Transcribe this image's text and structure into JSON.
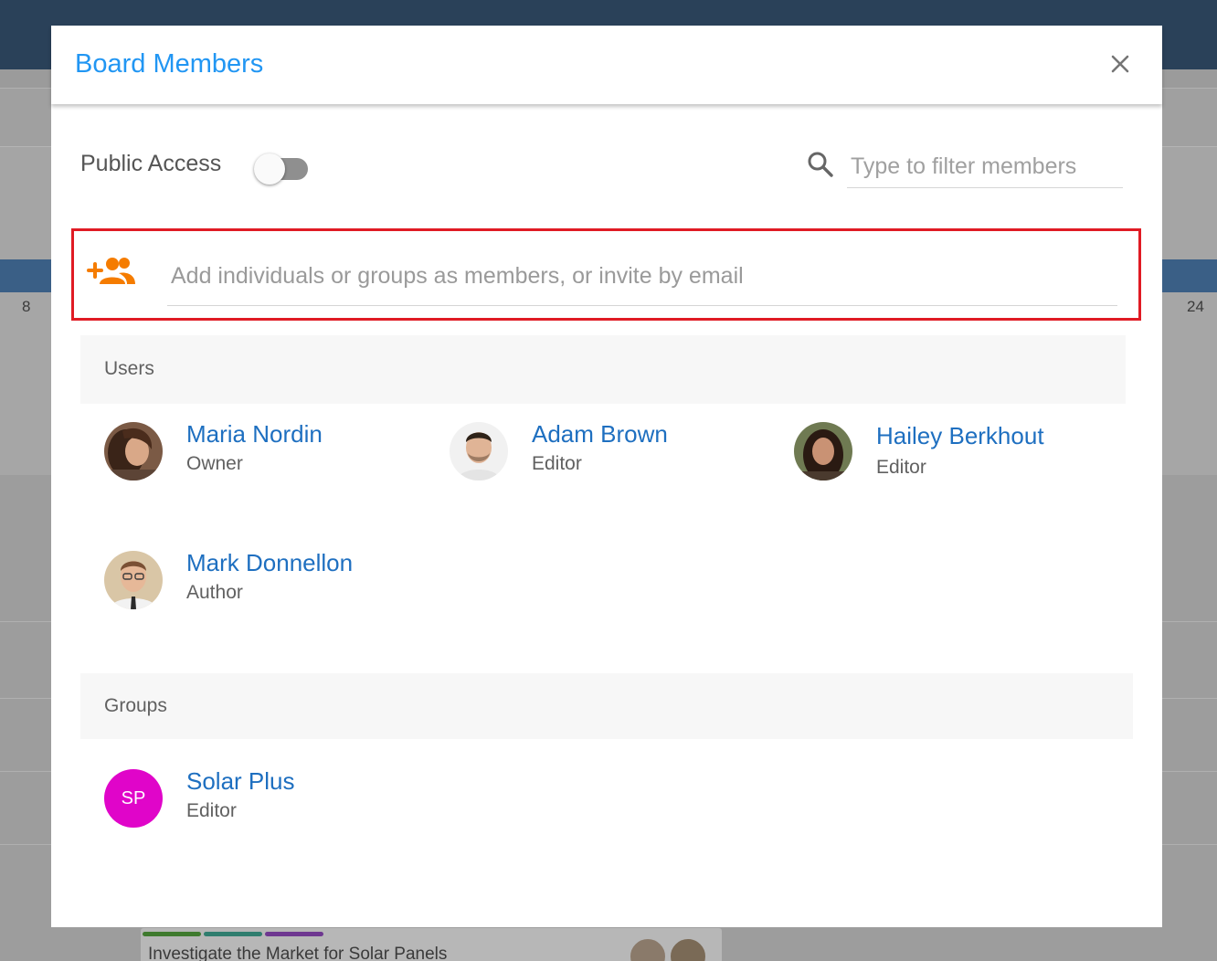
{
  "background": {
    "left_number": "8",
    "right_number": "24",
    "card_title": "Investigate the Market for Solar Panels",
    "tag_colors": [
      "#3f7a2e",
      "#2f7d6e",
      "#6e3790"
    ]
  },
  "modal": {
    "title": "Board Members",
    "close_icon": "close-icon"
  },
  "public_access": {
    "label": "Public Access",
    "enabled": false
  },
  "filter": {
    "placeholder": "Type to filter members",
    "value": ""
  },
  "add_members": {
    "icon": "add-group-icon",
    "placeholder": "Add individuals or groups as members, or invite by email",
    "accent_color": "#f57c00",
    "highlight_color": "#e01b24"
  },
  "users": {
    "heading": "Users",
    "items": [
      {
        "name": "Maria Nordin",
        "role": "Owner"
      },
      {
        "name": "Adam Brown",
        "role": "Editor"
      },
      {
        "name": "Hailey Berkhout",
        "role": "Editor"
      },
      {
        "name": "Mark Donnellon",
        "role": "Author"
      }
    ]
  },
  "groups": {
    "heading": "Groups",
    "items": [
      {
        "name": "Solar Plus",
        "role": "Editor",
        "initials": "SP",
        "color": "#e005c9"
      }
    ]
  },
  "colors": {
    "title_blue": "#2196f3",
    "name_blue": "#1e6fc0",
    "topbar": "#2a4159"
  }
}
